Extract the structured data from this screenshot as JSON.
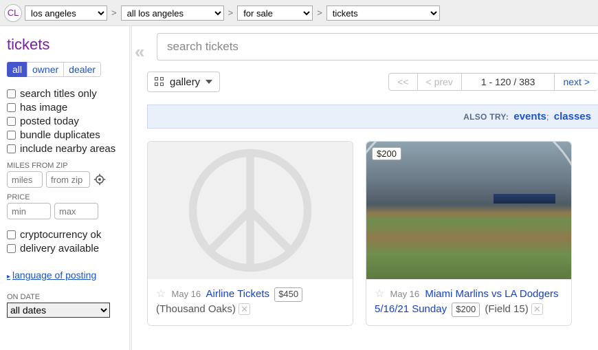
{
  "logo": "CL",
  "breadcrumbs": {
    "city": "los angeles",
    "area": "all los angeles",
    "section": "for sale",
    "category": "tickets"
  },
  "sidebar": {
    "title": "tickets",
    "tabs": {
      "all": "all",
      "owner": "owner",
      "dealer": "dealer"
    },
    "filters": {
      "titles_only": "search titles only",
      "has_image": "has image",
      "posted_today": "posted today",
      "bundle_dup": "bundle duplicates",
      "nearby": "include nearby areas"
    },
    "miles_label": "MILES FROM ZIP",
    "miles_ph": "miles",
    "zip_ph": "from zip",
    "price_label": "PRICE",
    "min_ph": "min",
    "max_ph": "max",
    "extra": {
      "crypto": "cryptocurrency ok",
      "delivery": "delivery available"
    },
    "lang": "language of posting",
    "on_date_label": "ON DATE",
    "on_date_value": "all dates"
  },
  "search": {
    "placeholder": "search tickets"
  },
  "toolbar": {
    "view": "gallery",
    "prev2": "<<",
    "prev": "< prev",
    "range": "1 - 120 / 383",
    "next": "next >"
  },
  "also_try": {
    "label": "ALSO TRY:",
    "link1": "events",
    "link2": "classes"
  },
  "listings": [
    {
      "date": "May 16",
      "title": "Airline Tickets",
      "price": "$450",
      "hood": "Thousand Oaks",
      "tag_price": null,
      "img": "peace"
    },
    {
      "date": "May 16",
      "title": "Miami Marlins vs LA Dodgers 5/16/21 Sunday",
      "price": "$200",
      "hood": "Field 15",
      "tag_price": "$200",
      "img": "stadium"
    }
  ]
}
